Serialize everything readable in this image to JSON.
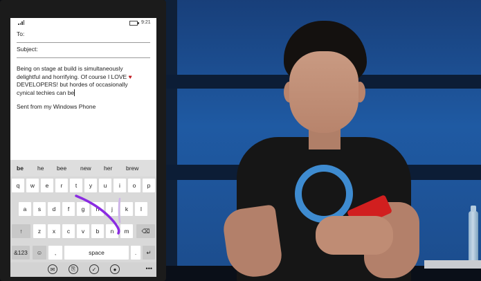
{
  "status_bar": {
    "time": "9:21"
  },
  "compose": {
    "to_label": "To:",
    "subject_label": "Subject:",
    "body_before_heart": "Being on stage at build is simultaneously delightful and horrifying. Of course I LOVE",
    "heart": "♥",
    "body_after_heart": "DEVELOPERS!  but hordes of occasionally cynical techies can be",
    "signature": "Sent from my Windows Phone"
  },
  "keyboard": {
    "suggestions": [
      "be",
      "he",
      "bee",
      "new",
      "her",
      "brew"
    ],
    "row1": [
      "q",
      "w",
      "e",
      "r",
      "t",
      "y",
      "u",
      "i",
      "o",
      "p"
    ],
    "row2": [
      "a",
      "s",
      "d",
      "f",
      "g",
      "h",
      "j",
      "k",
      "l"
    ],
    "row3": [
      "z",
      "x",
      "c",
      "v",
      "b",
      "n",
      "m"
    ],
    "shift": "↑",
    "backspace": "⌫",
    "num_key": "&123",
    "emoji_key": "☺",
    "comma_key": ",",
    "space_key": "space",
    "period_key": ".",
    "enter_key": "↵"
  },
  "app_bar": {
    "icons": [
      "save-draft-icon",
      "attach-icon",
      "send-icon",
      "microphone-icon"
    ],
    "more": "•••"
  },
  "colors": {
    "swipe_trail": "#8a2be2",
    "heart": "#c0161d",
    "shirt_logo": "#3e8bd0",
    "phone_red": "#d11f1f"
  }
}
